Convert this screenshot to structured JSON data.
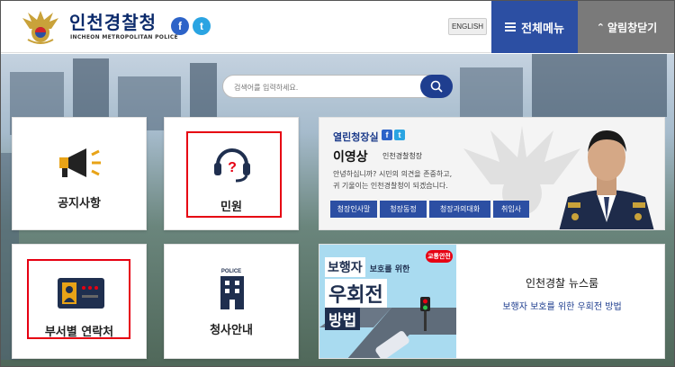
{
  "header": {
    "logo_title": "인천경찰청",
    "logo_subtitle": "INCHEON METROPOLITAN POLICE",
    "facebook_icon": "f",
    "twitter_icon": "t",
    "english_label": "ENGLISH",
    "menu_label": "전체메뉴",
    "notice_label": "알림창닫기"
  },
  "search": {
    "placeholder": "검색어를 입력하세요."
  },
  "tiles": {
    "notice_label": "공지사항",
    "civil_label": "민원",
    "dept_contact_label": "부서별 연락처",
    "building_label": "청사안내",
    "police_sign": "POLICE"
  },
  "chief": {
    "title": "열린청장실",
    "name": "이영상",
    "role": "인천경찰청장",
    "message_line1": "안녕하십니까? 시민의 의견을 존중하고,",
    "message_line2": "귀 기울이는 인천경찰청이 되겠습니다.",
    "links": [
      "청장인사말",
      "청장동정",
      "청장과의대화",
      "취임사"
    ]
  },
  "news": {
    "image_line1_a": "보행자",
    "image_line1_b": "보호를 위한",
    "image_line2": "우회전",
    "image_line3": "방법",
    "image_badge": "교통안전",
    "title": "인천경찰 뉴스룸",
    "subtitle": "보행자 보호를 위한 우회전 방법"
  },
  "colors": {
    "brand_blue": "#2c4fa3",
    "dark_navy": "#1f3e8f",
    "highlight_red": "#e60012",
    "gray_button": "#7a7a7a"
  }
}
